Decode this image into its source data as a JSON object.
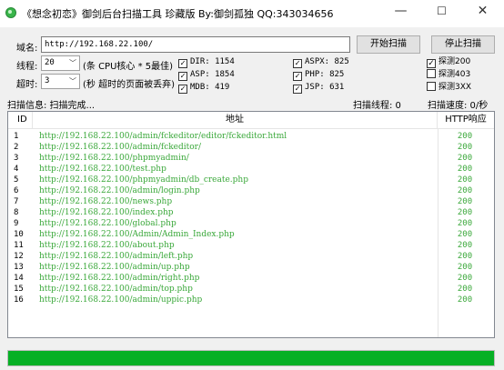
{
  "window": {
    "title": "《想念初恋》御剑后台扫描工具 珍藏版 By:御剑孤独 QQ:343034656",
    "minimize": "—",
    "maximize": "☐",
    "close": "✕"
  },
  "form": {
    "domain_label": "域名:",
    "domain_value": "http://192.168.22.100/",
    "threads_label": "线程:",
    "threads_value": "20",
    "threads_hint": "(条 CPU核心 * 5最佳)",
    "timeout_label": "超时:",
    "timeout_value": "3",
    "timeout_hint": "(秒 超时的页面被丢弃)",
    "start_button": "开始扫描",
    "stop_button": "停止扫描"
  },
  "dictionaries": [
    {
      "label": "DIR: 1154",
      "checked": true
    },
    {
      "label": "ASP: 1854",
      "checked": true
    },
    {
      "label": "MDB: 419",
      "checked": true
    },
    {
      "label": "ASPX: 825",
      "checked": true
    },
    {
      "label": "PHP: 825",
      "checked": true
    },
    {
      "label": "JSP: 631",
      "checked": true
    }
  ],
  "probes": [
    {
      "label": "探测200",
      "checked": true
    },
    {
      "label": "探测403",
      "checked": false
    },
    {
      "label": "探测3XX",
      "checked": false
    }
  ],
  "status": {
    "info": "扫描信息: 扫描完成...",
    "threads": "扫描线程: 0",
    "speed": "扫描速度: 0/秒"
  },
  "table": {
    "columns": [
      "ID",
      "地址",
      "HTTP响应"
    ],
    "rows": [
      {
        "id": "1",
        "url": "http://192.168.22.100/admin/fckeditor/editor/fckeditor.html",
        "code": "200"
      },
      {
        "id": "2",
        "url": "http://192.168.22.100/admin/fckeditor/",
        "code": "200"
      },
      {
        "id": "3",
        "url": "http://192.168.22.100/phpmyadmin/",
        "code": "200"
      },
      {
        "id": "4",
        "url": "http://192.168.22.100/test.php",
        "code": "200"
      },
      {
        "id": "5",
        "url": "http://192.168.22.100/phpmyadmin/db_create.php",
        "code": "200"
      },
      {
        "id": "6",
        "url": "http://192.168.22.100/admin/login.php",
        "code": "200"
      },
      {
        "id": "7",
        "url": "http://192.168.22.100/news.php",
        "code": "200"
      },
      {
        "id": "8",
        "url": "http://192.168.22.100/index.php",
        "code": "200"
      },
      {
        "id": "9",
        "url": "http://192.168.22.100/global.php",
        "code": "200"
      },
      {
        "id": "10",
        "url": "http://192.168.22.100/Admin/Admin_Index.php",
        "code": "200"
      },
      {
        "id": "11",
        "url": "http://192.168.22.100/about.php",
        "code": "200"
      },
      {
        "id": "12",
        "url": "http://192.168.22.100/admin/left.php",
        "code": "200"
      },
      {
        "id": "13",
        "url": "http://192.168.22.100/admin/up.php",
        "code": "200"
      },
      {
        "id": "14",
        "url": "http://192.168.22.100/admin/right.php",
        "code": "200"
      },
      {
        "id": "15",
        "url": "http://192.168.22.100/admin/top.php",
        "code": "200"
      },
      {
        "id": "16",
        "url": "http://192.168.22.100/admin/uppic.php",
        "code": "200"
      }
    ]
  },
  "progress": {
    "fraction": 1.0,
    "color": "#06b025"
  }
}
